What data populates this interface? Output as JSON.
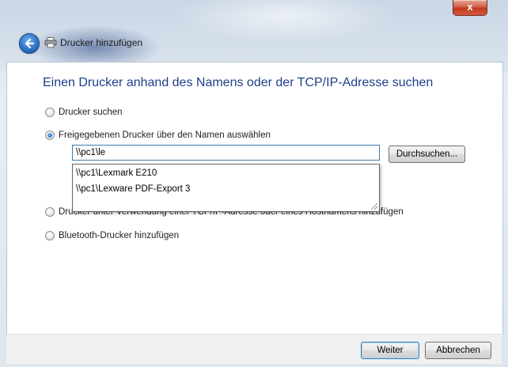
{
  "window": {
    "title": "Drucker hinzufügen",
    "close_glyph": "x"
  },
  "page": {
    "heading": "Einen Drucker anhand des Namens oder der TCP/IP-Adresse suchen"
  },
  "options": [
    {
      "label": "Drucker suchen",
      "checked": false
    },
    {
      "label": "Freigegebenen Drucker über den Namen auswählen",
      "checked": true
    },
    {
      "label": "Drucker unter Verwendung einer TCP/IP-Adresse oder eines Hostnamens hinzufügen",
      "checked": false
    },
    {
      "label": "Bluetooth-Drucker hinzufügen",
      "checked": false
    }
  ],
  "share_input": {
    "value": "\\\\pc1\\le",
    "browse_label": "Durchsuchen..."
  },
  "suggestions": [
    "\\\\pc1\\Lexmark E210",
    "\\\\pc1\\Lexware PDF-Export 3"
  ],
  "footer": {
    "next_label": "Weiter",
    "cancel_label": "Abbrechen"
  },
  "icons": {
    "back": "back-arrow-icon",
    "printer": "printer-icon",
    "close": "close-icon"
  },
  "colors": {
    "heading": "#1e3f8a",
    "close_button": "#c2391e",
    "back_button": "#2f74c9"
  }
}
